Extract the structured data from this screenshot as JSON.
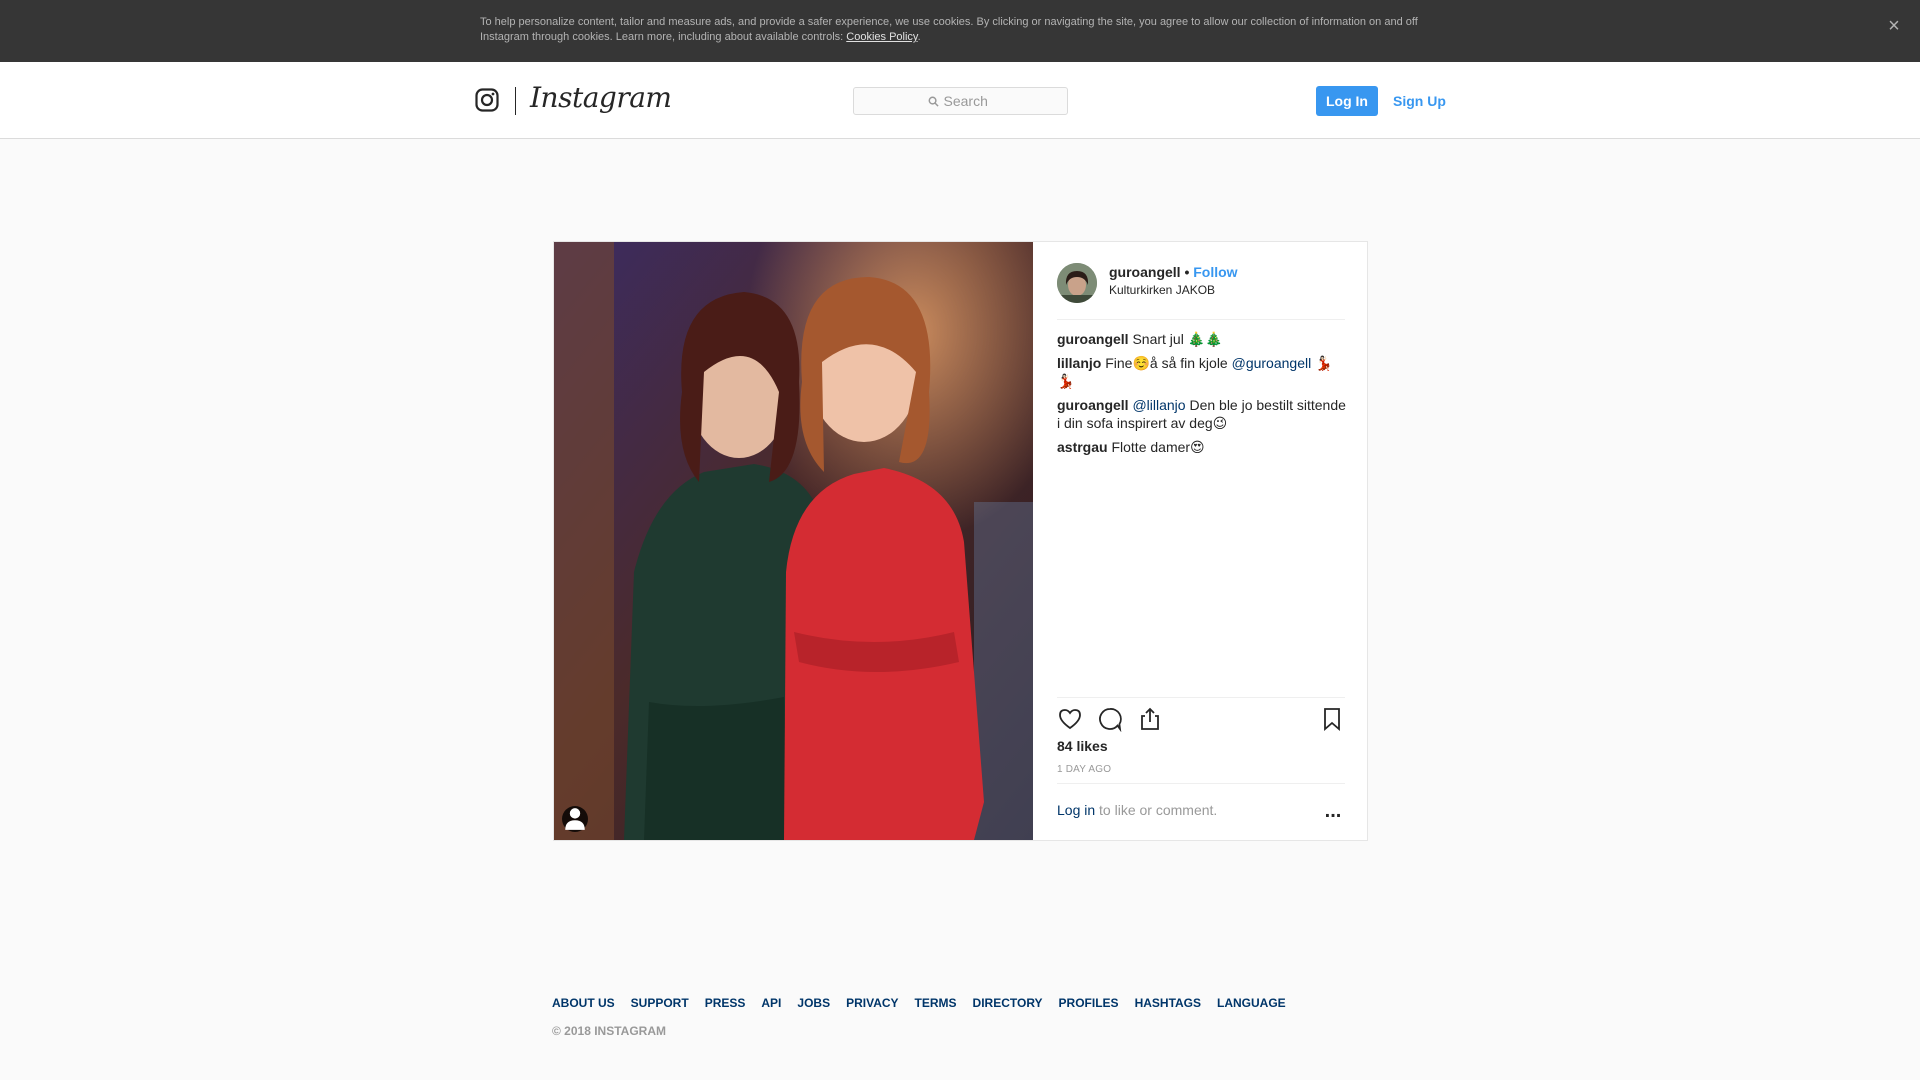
{
  "cookie_banner": {
    "text": "To help personalize content, tailor and measure ads, and provide a safer experience, we use cookies. By clicking or navigating the site, you agree to allow our collection of information on and off Instagram through cookies. Learn more, including about available controls: ",
    "link": "Cookies Policy",
    "link_suffix": ".",
    "close_icon": "×"
  },
  "header": {
    "logo_text": "Instagram",
    "search_placeholder": "Search",
    "login_label": "Log In",
    "signup_label": "Sign Up"
  },
  "post": {
    "username": "guroangell",
    "separator": " • ",
    "follow_label": "Follow",
    "location": "Kulturkirken JAKOB",
    "comments": [
      {
        "user": "guroangell",
        "pre": " Snart jul 🎄🎄",
        "mention": "",
        "post": ""
      },
      {
        "user": "lillanjo",
        "pre": " Fine☺️å så fin kjole ",
        "mention": "@guroangell",
        "post": " 💃🏻💃🏻"
      },
      {
        "user": "guroangell",
        "pre": " ",
        "mention": "@lillanjo",
        "post": " Den ble jo bestilt sittende i din sofa inspirert av deg😉"
      },
      {
        "user": "astrgau",
        "pre": " Flotte damer😍",
        "mention": "",
        "post": ""
      }
    ],
    "likes": "84 likes",
    "time_ago": "1 day ago",
    "login_link": "Log in",
    "login_suffix": " to like or comment.",
    "more_label": "..."
  },
  "footer": {
    "links": [
      "About us",
      "Support",
      "Press",
      "API",
      "Jobs",
      "Privacy",
      "Terms",
      "Directory",
      "Profiles",
      "Hashtags",
      "Language"
    ],
    "copyright": "© 2018 Instagram"
  },
  "colors": {
    "accent": "#3897f0",
    "link": "#003569",
    "banner_bg": "#363636",
    "muted": "#999999"
  },
  "icons": [
    "close-icon",
    "instagram-camera-icon",
    "search-icon",
    "heart-icon",
    "comment-icon",
    "share-icon",
    "bookmark-icon",
    "more-icon",
    "user-tag-icon"
  ]
}
